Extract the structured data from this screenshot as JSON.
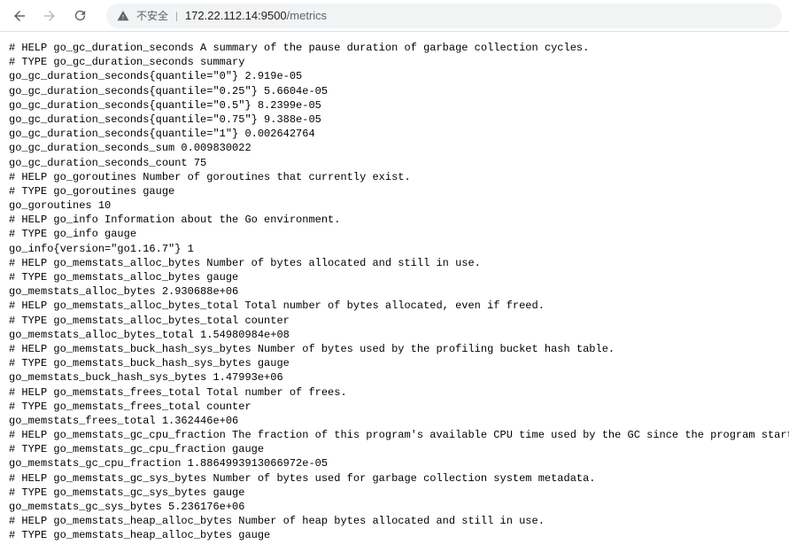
{
  "toolbar": {
    "security_label": "不安全",
    "url_host": "172.22.112.14:9500",
    "url_path": "/metrics"
  },
  "metrics_lines": [
    "# HELP go_gc_duration_seconds A summary of the pause duration of garbage collection cycles.",
    "# TYPE go_gc_duration_seconds summary",
    "go_gc_duration_seconds{quantile=\"0\"} 2.919e-05",
    "go_gc_duration_seconds{quantile=\"0.25\"} 5.6604e-05",
    "go_gc_duration_seconds{quantile=\"0.5\"} 8.2399e-05",
    "go_gc_duration_seconds{quantile=\"0.75\"} 9.388e-05",
    "go_gc_duration_seconds{quantile=\"1\"} 0.002642764",
    "go_gc_duration_seconds_sum 0.009830022",
    "go_gc_duration_seconds_count 75",
    "# HELP go_goroutines Number of goroutines that currently exist.",
    "# TYPE go_goroutines gauge",
    "go_goroutines 10",
    "# HELP go_info Information about the Go environment.",
    "# TYPE go_info gauge",
    "go_info{version=\"go1.16.7\"} 1",
    "# HELP go_memstats_alloc_bytes Number of bytes allocated and still in use.",
    "# TYPE go_memstats_alloc_bytes gauge",
    "go_memstats_alloc_bytes 2.930688e+06",
    "# HELP go_memstats_alloc_bytes_total Total number of bytes allocated, even if freed.",
    "# TYPE go_memstats_alloc_bytes_total counter",
    "go_memstats_alloc_bytes_total 1.54980984e+08",
    "# HELP go_memstats_buck_hash_sys_bytes Number of bytes used by the profiling bucket hash table.",
    "# TYPE go_memstats_buck_hash_sys_bytes gauge",
    "go_memstats_buck_hash_sys_bytes 1.47993e+06",
    "# HELP go_memstats_frees_total Total number of frees.",
    "# TYPE go_memstats_frees_total counter",
    "go_memstats_frees_total 1.362446e+06",
    "# HELP go_memstats_gc_cpu_fraction The fraction of this program's available CPU time used by the GC since the program started.",
    "# TYPE go_memstats_gc_cpu_fraction gauge",
    "go_memstats_gc_cpu_fraction 1.8864993913066972e-05",
    "# HELP go_memstats_gc_sys_bytes Number of bytes used for garbage collection system metadata.",
    "# TYPE go_memstats_gc_sys_bytes gauge",
    "go_memstats_gc_sys_bytes 5.236176e+06",
    "# HELP go_memstats_heap_alloc_bytes Number of heap bytes allocated and still in use.",
    "# TYPE go_memstats_heap_alloc_bytes gauge"
  ]
}
